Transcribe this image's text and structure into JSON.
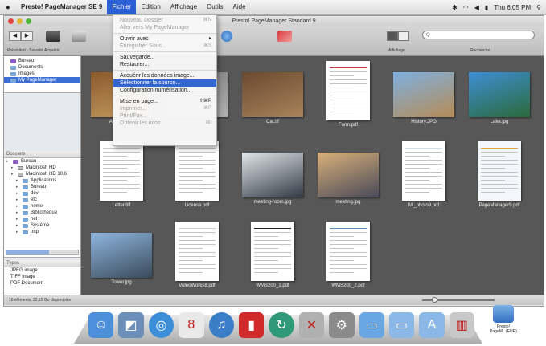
{
  "menubar": {
    "apple": "",
    "app_name": "Presto! PageManager SE 9",
    "menus": [
      "Fichier",
      "Edition",
      "Affichage",
      "Outils",
      "Aide"
    ],
    "clock": "Thu 6:05 PM",
    "status_icons": [
      "bluetooth-icon",
      "wifi-icon",
      "volume-icon",
      "battery-icon",
      "search-icon"
    ]
  },
  "window": {
    "title": "Presto! PageManager Standard 9",
    "search_placeholder": "Q",
    "toolbar_labels": [
      "Précédent - Suivant",
      "Acquérir",
      "Affichage",
      "Recherche"
    ]
  },
  "file_menu": {
    "items": [
      {
        "label": "Nouveau Dossier",
        "shortcut": "⌘N",
        "enabled": false
      },
      {
        "label": "Aller vers My PageManager",
        "shortcut": "",
        "enabled": false
      },
      {
        "sep": true
      },
      {
        "label": "Ouvrir avec",
        "shortcut": "▸",
        "enabled": true
      },
      {
        "label": "Enregistrer Sous...",
        "shortcut": "⌘S",
        "enabled": false
      },
      {
        "sep": true
      },
      {
        "label": "Sauvegarde...",
        "shortcut": "",
        "enabled": true
      },
      {
        "label": "Restaurer...",
        "shortcut": "",
        "enabled": true
      },
      {
        "sep": true
      },
      {
        "label": "Acquérir les données image...",
        "shortcut": "",
        "enabled": true
      },
      {
        "label": "Sélectionner la source...",
        "shortcut": "",
        "enabled": true,
        "highlighted": true
      },
      {
        "label": "Configuration numérisation...",
        "shortcut": "",
        "enabled": true
      },
      {
        "sep": true
      },
      {
        "label": "Mise en page...",
        "shortcut": "⇧⌘P",
        "enabled": true
      },
      {
        "label": "Imprimer...",
        "shortcut": "⌘P",
        "enabled": false
      },
      {
        "label": "Print/Fax...",
        "shortcut": "",
        "enabled": false
      },
      {
        "label": "Obtenir les infos",
        "shortcut": "⌘I",
        "enabled": false
      }
    ]
  },
  "sidebar": {
    "top_items": [
      {
        "label": "Bureau",
        "selected": false
      },
      {
        "label": "Documents",
        "selected": false
      },
      {
        "label": "Images",
        "selected": false
      },
      {
        "label": "My PageManager",
        "selected": true
      }
    ],
    "tree_header": "Dossiers",
    "tree": [
      {
        "label": "Bureau",
        "indent": 0
      },
      {
        "label": "Macintosh HD",
        "indent": 1
      },
      {
        "label": "Macintosh HD 10.6",
        "indent": 1
      },
      {
        "label": "Applications",
        "indent": 2
      },
      {
        "label": "Bureau",
        "indent": 2
      },
      {
        "label": "dev",
        "indent": 2
      },
      {
        "label": "etc",
        "indent": 2
      },
      {
        "label": "home",
        "indent": 2
      },
      {
        "label": "Bibliothèque",
        "indent": 2
      },
      {
        "label": "net",
        "indent": 2
      },
      {
        "label": "Système",
        "indent": 2
      },
      {
        "label": "tmp",
        "indent": 2
      }
    ],
    "types_header": "Types",
    "types": [
      "JPEG image",
      "TIFF image",
      "PDF Document"
    ]
  },
  "thumbnails": [
    {
      "name": "Autumn.jpg",
      "kind": "photo",
      "colors": [
        "#8a5a2c",
        "#c9a063"
      ]
    },
    {
      "name": "",
      "kind": "photo",
      "colors": [
        "#7a7a7a",
        "#b0b0b0"
      ]
    },
    {
      "name": "Cat.tif",
      "kind": "photo",
      "colors": [
        "#6a4a30",
        "#a9835a"
      ]
    },
    {
      "name": "Form.pdf",
      "kind": "doc",
      "colors": [
        "#ffffff",
        "#d23b3b"
      ]
    },
    {
      "name": "History.JPG",
      "kind": "photo",
      "colors": [
        "#7fb0e0",
        "#b58b55"
      ]
    },
    {
      "name": "Lake.jpg",
      "kind": "photo",
      "colors": [
        "#3f8fd6",
        "#2a6a3a"
      ]
    },
    {
      "name": "Letter.tiff",
      "kind": "doc",
      "colors": [
        "#ffffff",
        "#cccccc"
      ]
    },
    {
      "name": "License.pdf",
      "kind": "doc",
      "colors": [
        "#ffffff",
        "#cccccc"
      ]
    },
    {
      "name": "meeting-room.jpg",
      "kind": "photo",
      "colors": [
        "#dfe6ea",
        "#333a44"
      ]
    },
    {
      "name": "meeting.jpg",
      "kind": "photo",
      "colors": [
        "#d8b07a",
        "#4a4a58"
      ]
    },
    {
      "name": "Mi_photo9.pdf",
      "kind": "doc",
      "colors": [
        "#ffffff",
        "#cfe1ef"
      ]
    },
    {
      "name": "PageManager9.pdf",
      "kind": "doc",
      "colors": [
        "#f3f6fb",
        "#e8a23a"
      ]
    },
    {
      "name": "Tower.jpg",
      "kind": "photo",
      "colors": [
        "#8fb6e0",
        "#3a4a5a"
      ]
    },
    {
      "name": "VideoWorks8.pdf",
      "kind": "doc",
      "colors": [
        "#ffffff",
        "#cccccc"
      ]
    },
    {
      "name": "WMS200_1.pdf",
      "kind": "doc",
      "colors": [
        "#ffffff",
        "#222222"
      ]
    },
    {
      "name": "WMS200_2.pdf",
      "kind": "doc",
      "colors": [
        "#ffffff",
        "#5a8ac0"
      ]
    }
  ],
  "statusbar": {
    "text": "16 éléments, 22,15 Go disponibles",
    "thumbnail_size_level": 0.15
  },
  "dock": {
    "items": [
      {
        "name": "finder-dock-icon",
        "glyph": "☺",
        "color": "#4d8fd8"
      },
      {
        "name": "preview-dock-icon",
        "glyph": "◩",
        "color": "#6b8fb8"
      },
      {
        "name": "safari-dock-icon",
        "glyph": "◎",
        "color": "#3d8ed8"
      },
      {
        "name": "ical-dock-icon",
        "glyph": "8",
        "color": "#e9e9e9"
      },
      {
        "name": "itunes-dock-icon",
        "glyph": "♫",
        "color": "#3a7ec8"
      },
      {
        "name": "photobooth-dock-icon",
        "glyph": "▮",
        "color": "#d02a2a"
      },
      {
        "name": "timemachine-dock-icon",
        "glyph": "↻",
        "color": "#2f9a78"
      },
      {
        "name": "pagemanager-dock-icon",
        "glyph": "✕",
        "color": "#b0b0b0"
      },
      {
        "name": "system-preferences-dock-icon",
        "glyph": "⚙",
        "color": "#8a8a8a"
      },
      {
        "name": "folder-dock-icon",
        "glyph": "▭",
        "color": "#6aa6e2"
      },
      {
        "name": "documents-stack-dock-icon",
        "glyph": "▭",
        "color": "#8cb8e8"
      },
      {
        "name": "applications-stack-dock-icon",
        "glyph": "A",
        "color": "#8cb8e8"
      },
      {
        "name": "trash-dock-icon",
        "glyph": "▥",
        "color": "#c8c8c8"
      }
    ]
  },
  "desktop": {
    "icon_label": "Presto!\nPageM...(EUR)"
  }
}
